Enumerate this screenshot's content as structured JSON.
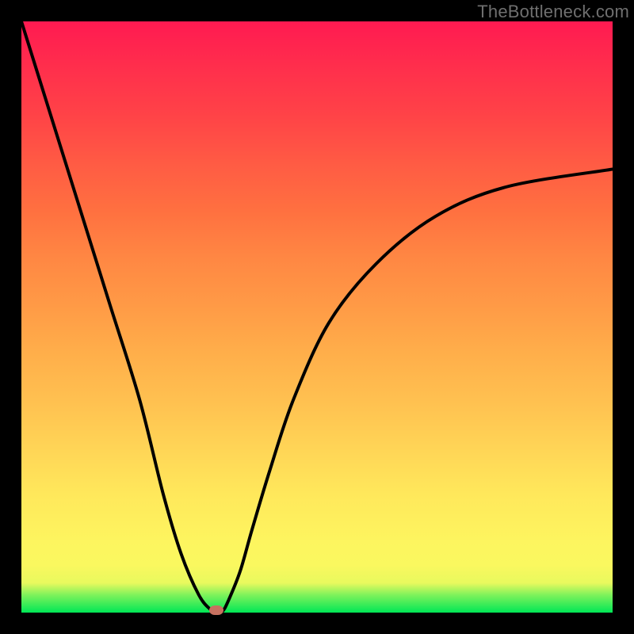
{
  "watermark": "TheBottleneck.com",
  "colors": {
    "curve_stroke": "#000000",
    "marker_fill": "#c77160",
    "frame": "#000000"
  },
  "chart_data": {
    "type": "line",
    "title": "",
    "xlabel": "",
    "ylabel": "",
    "xlim": [
      0,
      100
    ],
    "ylim": [
      0,
      100
    ],
    "grid": false,
    "series": [
      {
        "name": "bottleneck-curve",
        "x": [
          0,
          5,
          10,
          15,
          20,
          24,
          27,
          30,
          32,
          33,
          34,
          35,
          37,
          39,
          42,
          46,
          52,
          60,
          70,
          82,
          100
        ],
        "values": [
          100,
          84,
          68,
          52,
          36,
          20,
          10,
          3,
          0.5,
          0,
          0.2,
          2,
          7,
          14,
          24,
          36,
          49,
          59,
          67,
          72,
          75
        ]
      }
    ],
    "markers": [
      {
        "name": "optimal-point",
        "x": 33,
        "y": 0
      }
    ]
  }
}
